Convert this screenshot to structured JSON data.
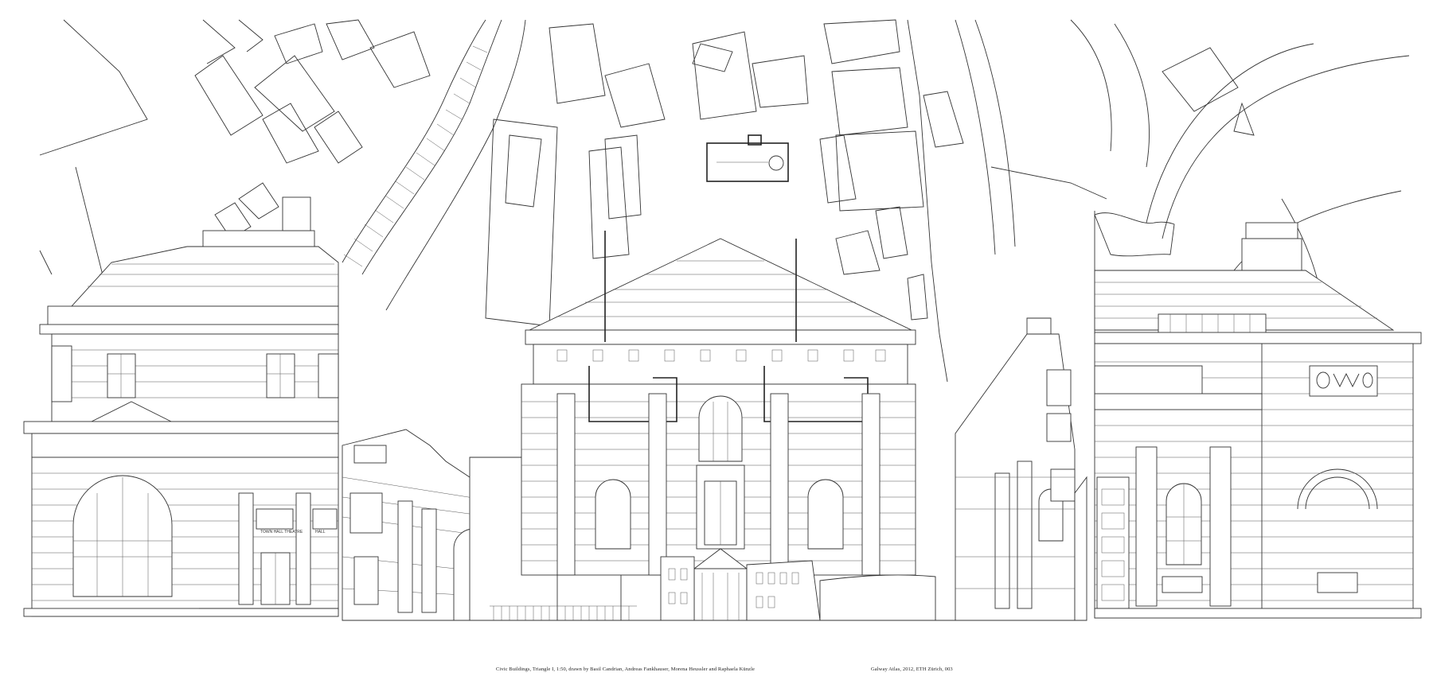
{
  "caption": {
    "left": "Civic Buildings, Triangle I, 1:50, drawn by Basil Candrian, Andreas Fankhauser, Morena Heussler and Raphaela Künzle",
    "right": "Galway Atlas, 2012, ETH Zürich, 003"
  },
  "drawing": {
    "inscriptions": [
      "TOWN HALL THEATRE",
      "HALL"
    ],
    "line_color": "#333333",
    "paper_color": "#ffffff"
  }
}
